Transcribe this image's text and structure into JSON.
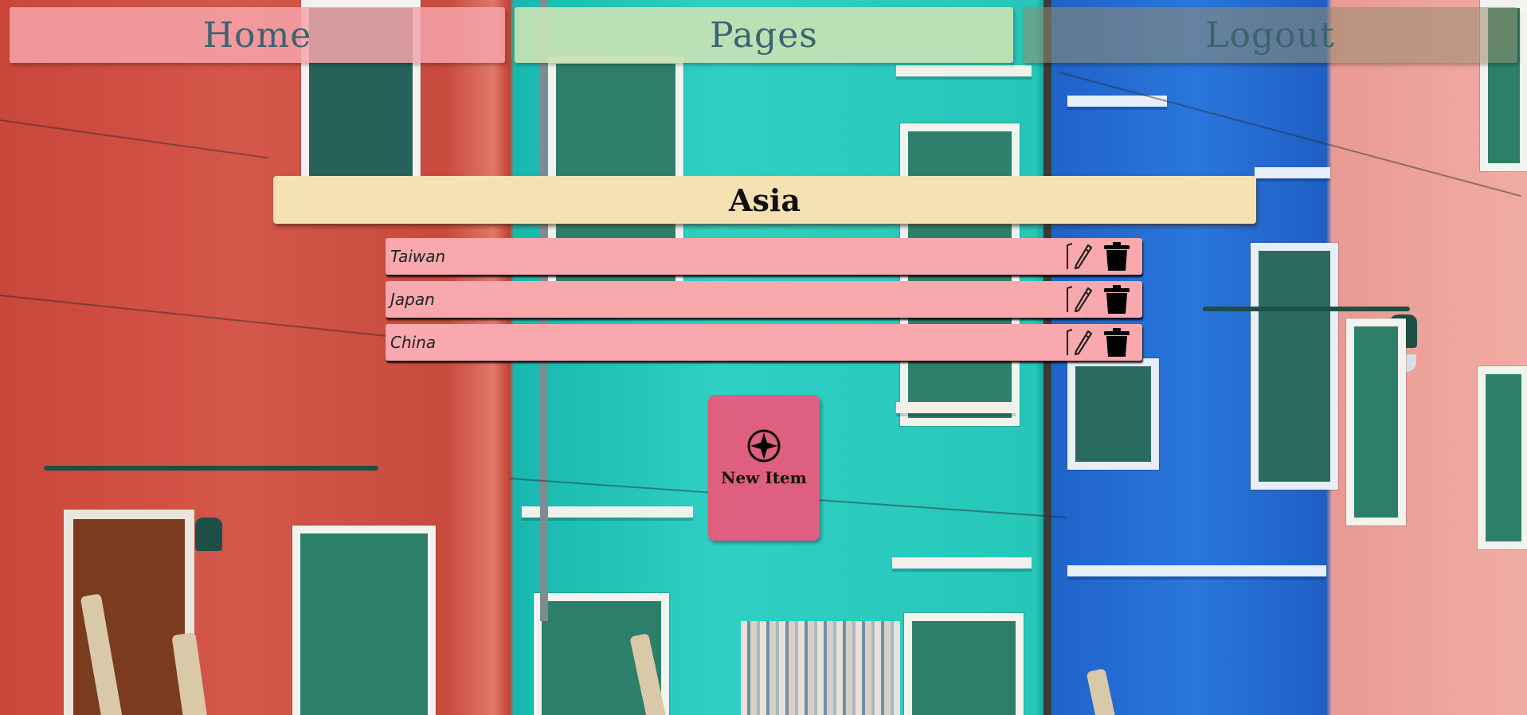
{
  "nav": {
    "home_label": "Home",
    "pages_label": "Pages",
    "logout_label": "Logout"
  },
  "category": {
    "title": "Asia"
  },
  "items": [
    {
      "label": "Taiwan"
    },
    {
      "label": "Japan"
    },
    {
      "label": "China"
    }
  ],
  "new_item": {
    "label": "New Item",
    "icon": "plus-circle-icon"
  },
  "icons": {
    "edit": "pencil-icon",
    "delete": "trash-icon"
  },
  "colors": {
    "nav_home": "#f6a4aa",
    "nav_pages": "#c8e2b4",
    "nav_text": "#3b6470",
    "category_bg": "#f6e1b3",
    "row_bg": "#f9a9ad",
    "new_item_bg": "#de5f7f"
  }
}
